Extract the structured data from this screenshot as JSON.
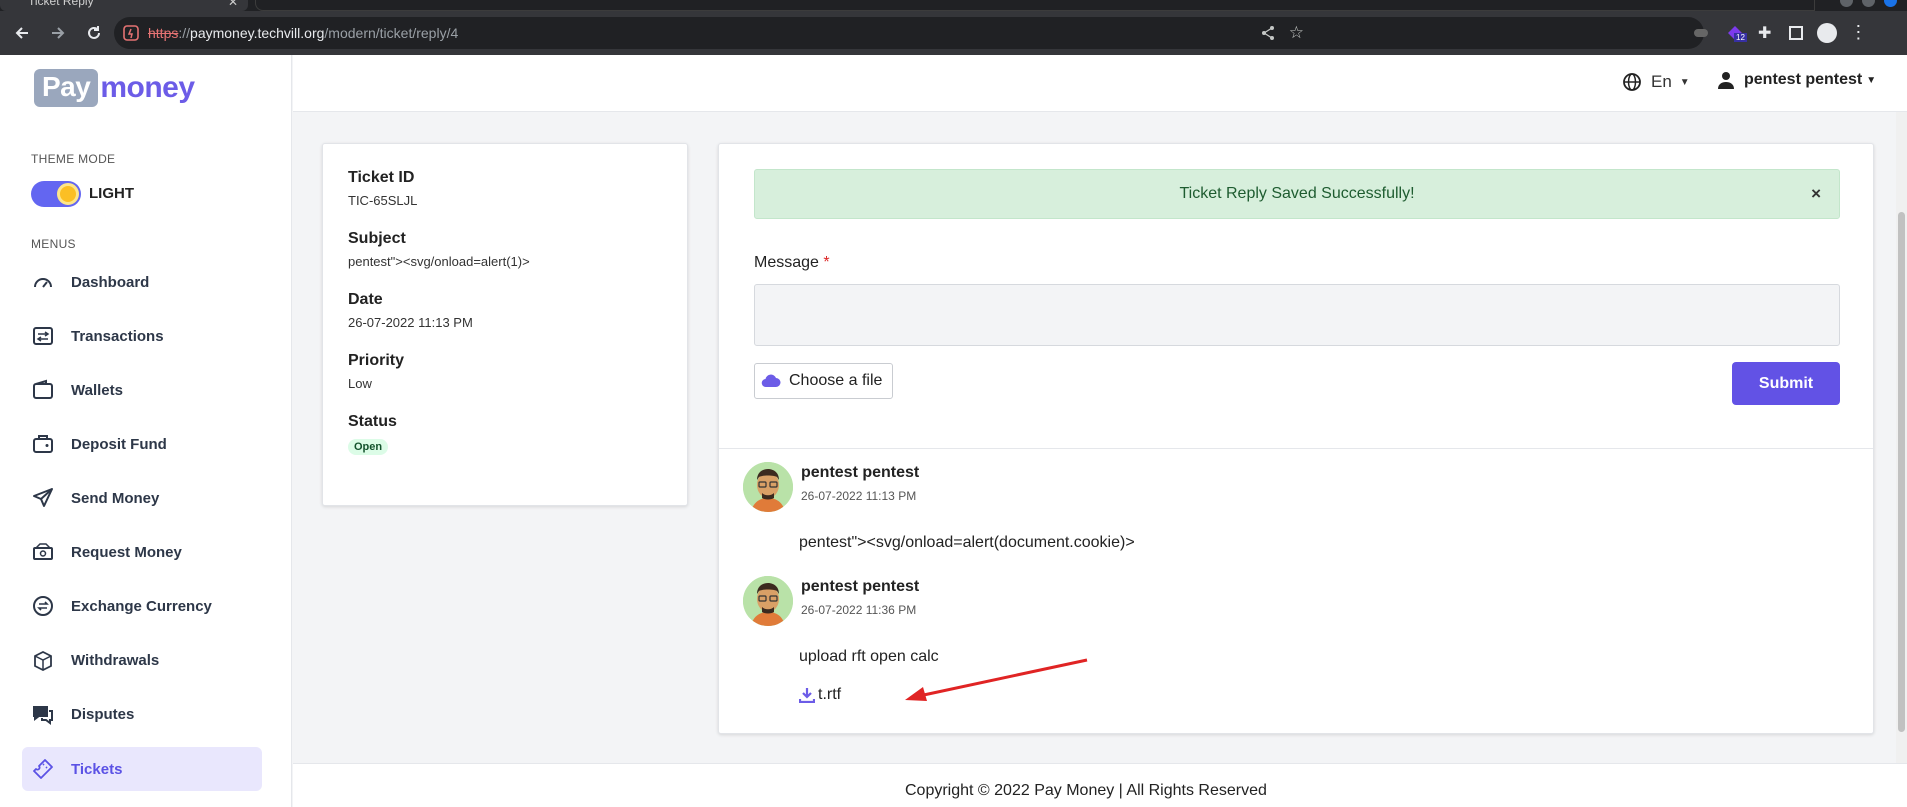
{
  "browser": {
    "tab_title": "Ticket Reply",
    "url_protocol": "https",
    "url_host": "paymoney.techvill.org",
    "url_path": "/modern/ticket/reply/4",
    "extension_badge": "12"
  },
  "sidebar": {
    "logo_left": "Pay",
    "logo_right": "money",
    "theme_mode_label": "THEME MODE",
    "theme_value": "LIGHT",
    "menus_label": "MENUS",
    "items": [
      {
        "label": "Dashboard",
        "icon": "dashboard-icon"
      },
      {
        "label": "Transactions",
        "icon": "transactions-icon"
      },
      {
        "label": "Wallets",
        "icon": "wallet-icon"
      },
      {
        "label": "Deposit Fund",
        "icon": "deposit-icon"
      },
      {
        "label": "Send Money",
        "icon": "send-icon"
      },
      {
        "label": "Request Money",
        "icon": "request-money-icon"
      },
      {
        "label": "Exchange Currency",
        "icon": "exchange-icon"
      },
      {
        "label": "Withdrawals",
        "icon": "withdrawals-icon"
      },
      {
        "label": "Disputes",
        "icon": "disputes-icon"
      },
      {
        "label": "Tickets",
        "icon": "ticket-icon",
        "active": true
      }
    ]
  },
  "header": {
    "language": "En",
    "user_name": "pentest pentest"
  },
  "ticket": {
    "id_label": "Ticket ID",
    "id_value": "TIC-65SLJL",
    "subject_label": "Subject",
    "subject_value": "pentest\"><svg/onload=alert(1)>",
    "date_label": "Date",
    "date_value": "26-07-2022 11:13 PM",
    "priority_label": "Priority",
    "priority_value": "Low",
    "status_label": "Status",
    "status_value": "Open"
  },
  "reply_form": {
    "alert_text": "Ticket Reply Saved Successfully!",
    "alert_close": "×",
    "message_label": "Message",
    "required_mark": "*",
    "message_value": "",
    "file_button": "Choose a file",
    "submit_button": "Submit"
  },
  "replies": [
    {
      "name": "pentest pentest",
      "date": "26-07-2022 11:13 PM",
      "text": "pentest\"><svg/onload=alert(document.cookie)>"
    },
    {
      "name": "pentest pentest",
      "date": "26-07-2022 11:36 PM",
      "text": "upload rft open calc",
      "attachment": "t.rtf"
    }
  ],
  "footer": {
    "copyright": "Copyright © 2022    Pay Money | All Rights Reserved"
  },
  "colors": {
    "accent": "#6252e5",
    "alert_bg": "#d7efdc",
    "active_menu_bg": "#e9e7fd",
    "annotation_arrow": "#e02424"
  }
}
